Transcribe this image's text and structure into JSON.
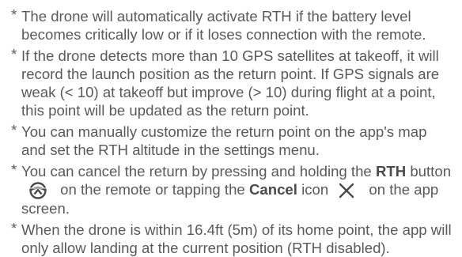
{
  "bullet_symbol": "*",
  "notes": [
    {
      "text": "The drone will automatically activate RTH if the battery level becomes critically low or if it loses connection with the remote."
    },
    {
      "text": "If the drone detects more than 10 GPS satellites at takeoff, it will record the launch position as the return point. If GPS signals are weak (< 10) at takeoff but improve (> 10) during flight at a point, this point will be updated as the return point."
    },
    {
      "text": "You can manually customize the return point on the app's map and set the RTH altitude in the settings menu."
    },
    {
      "part1": "You can cancel the return by pressing and holding the ",
      "bold1": "RTH",
      "part2": " button",
      "rth_icon": "rth-home-icon",
      "part3": " on the remote or tapping the ",
      "bold2": "Cancel",
      "part4": " icon",
      "cancel_icon": "close-x-icon",
      "part5": " on the app screen."
    },
    {
      "text": "When the drone is within 16.4ft (5m) of its home point, the app will only allow landing at the current position (RTH disabled)."
    }
  ],
  "colors": {
    "text": "#5a5a5a",
    "icon": "#4a4a4a"
  }
}
